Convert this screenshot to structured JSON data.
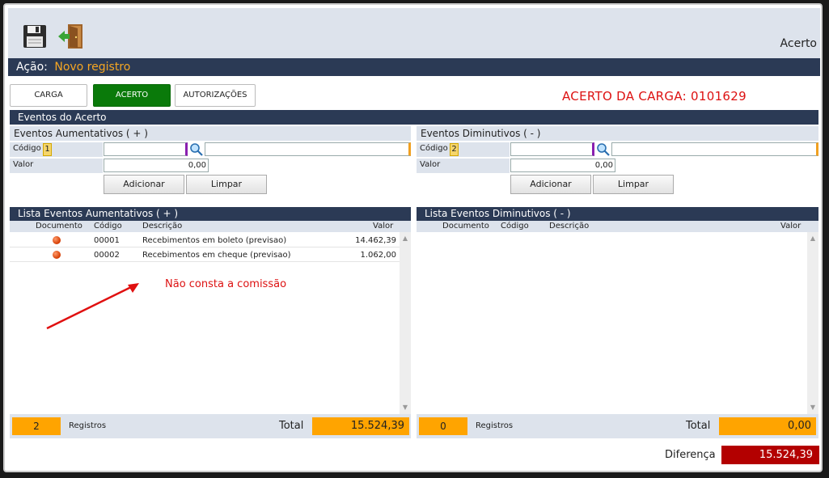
{
  "toolbar": {
    "save_icon": "floppy-disk-icon",
    "exit_icon": "exit-door-icon",
    "title": "Acerto"
  },
  "action": {
    "label": "Ação:",
    "value": "Novo registro"
  },
  "tabs": [
    {
      "label": "CARGA",
      "active": false
    },
    {
      "label": "ACERTO",
      "active": true
    },
    {
      "label": "AUTORIZAÇÕES",
      "active": false
    }
  ],
  "acerto_heading": "ACERTO DA CARGA: 0101629",
  "eventos_section": "Eventos do Acerto",
  "aumentativos": {
    "title": "Eventos Aumentativos ( + )",
    "codigo_label": "Código",
    "codigo_badge": "1",
    "valor_label": "Valor",
    "valor_value": "0,00",
    "add_button": "Adicionar",
    "clear_button": "Limpar"
  },
  "diminutivos": {
    "title": "Eventos Diminutivos ( - )",
    "codigo_label": "Código",
    "codigo_badge": "2",
    "valor_label": "Valor",
    "valor_value": "0,00",
    "add_button": "Adicionar",
    "clear_button": "Limpar"
  },
  "lista_aumentativos": {
    "title": "Lista Eventos Aumentativos ( + )",
    "columns": [
      "Documento",
      "Código",
      "Descrição",
      "Valor"
    ],
    "rows": [
      {
        "codigo": "00001",
        "descricao": "Recebimentos em boleto (previsao)",
        "valor": "14.462,39"
      },
      {
        "codigo": "00002",
        "descricao": "Recebimentos em cheque (previsao)",
        "valor": "1.062,00"
      }
    ],
    "count": "2",
    "registros_label": "Registros",
    "total_label": "Total",
    "total_value": "15.524,39"
  },
  "lista_diminutivos": {
    "title": "Lista Eventos Diminutivos ( - )",
    "columns": [
      "Documento",
      "Código",
      "Descrição",
      "Valor"
    ],
    "rows": [],
    "count": "0",
    "registros_label": "Registros",
    "total_label": "Total",
    "total_value": "0,00"
  },
  "annotation": "Não consta a comissão",
  "diferenca": {
    "label": "Diferença",
    "value": "15.524,39"
  },
  "colors": {
    "header_bar": "#2b3a55",
    "panel_bg": "#dde3ec",
    "active_tab": "#0a7a0a",
    "accent_orange": "#ffa400",
    "alert_red": "#b30000"
  }
}
